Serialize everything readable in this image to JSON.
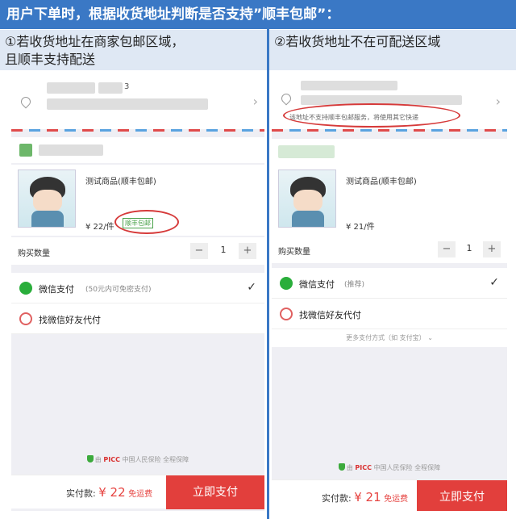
{
  "header": {
    "title": "用户下单时，根据收货地址判断是否支持”顺丰包邮”："
  },
  "columns": {
    "left_title_line1": "①若收货地址在商家包邮区域，",
    "left_title_line2": "且顺丰支持配送",
    "right_title": "②若收货地址不在可配送区域"
  },
  "left_phone": {
    "address_partial": "3",
    "goods_name": "测试商品(顺丰包邮)",
    "price": "¥ 22/件",
    "shipping_badge": "顺丰包邮",
    "qty_label": "购买数量",
    "qty_minus": "−",
    "qty_value": "1",
    "qty_plus": "+",
    "pay_wechat": "微信支付",
    "pay_wechat_note": "(50元内可免密支付)",
    "pay_friend": "找微信好友代付",
    "guarantee_prefix": "由",
    "guarantee_brand": "PICC",
    "guarantee_text": "中国人民保险 全程保障",
    "total_label": "实付款:",
    "total_amount": "¥ 22",
    "free_shipping": "免运费",
    "pay_button": "立即支付"
  },
  "right_phone": {
    "address_warning": "该地址不支持顺丰包邮服务，将使用其它快递",
    "goods_name": "测试商品(顺丰包邮)",
    "price": "¥ 21/件",
    "qty_label": "购买数量",
    "qty_minus": "−",
    "qty_value": "1",
    "qty_plus": "+",
    "pay_wechat": "微信支付",
    "pay_wechat_note": "(推荐)",
    "pay_friend": "找微信好友代付",
    "more_pay": "更多支付方式（如 支付宝）",
    "guarantee_prefix": "由",
    "guarantee_brand": "PICC",
    "guarantee_text": "中国人民保险 全程保障",
    "total_label": "实付款:",
    "total_amount": "¥ 21",
    "free_shipping": "免运费",
    "pay_button": "立即支付"
  },
  "colors": {
    "header_blue": "#3a78c5",
    "wechat_green": "#2aae3b",
    "price_red": "#e64340",
    "annotation_red": "#d63a3a"
  }
}
